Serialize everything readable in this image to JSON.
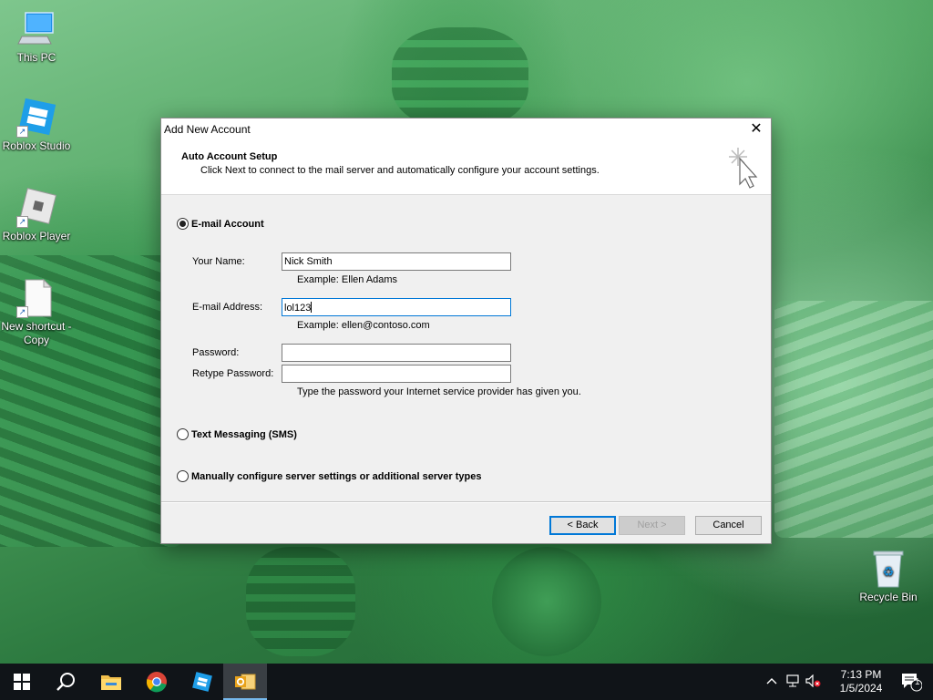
{
  "desktop": {
    "icons": [
      {
        "label": "This PC"
      },
      {
        "label": "Roblox Studio"
      },
      {
        "label": "Roblox Player"
      },
      {
        "label": "New shortcut - Copy"
      },
      {
        "label": "Recycle Bin"
      }
    ]
  },
  "dialog": {
    "title": "Add New Account",
    "close_glyph": "✕",
    "header": {
      "title": "Auto Account Setup",
      "subtitle": "Click Next to connect to the mail server and automatically configure your account settings."
    },
    "options": {
      "email": {
        "label": "E-mail Account",
        "checked": true
      },
      "sms": {
        "label": "Text Messaging (SMS)",
        "checked": false
      },
      "manual": {
        "label": "Manually configure server settings or additional server types",
        "checked": false
      }
    },
    "fields": {
      "name": {
        "label": "Your Name:",
        "value": "Nick Smith",
        "hint": "Example: Ellen Adams"
      },
      "email": {
        "label": "E-mail Address:",
        "value": "lol123",
        "hint": "Example: ellen@contoso.com"
      },
      "password": {
        "label": "Password:",
        "value": ""
      },
      "retype": {
        "label": "Retype Password:",
        "value": ""
      },
      "password_hint": "Type the password your Internet service provider has given you."
    },
    "buttons": {
      "back": "< Back",
      "next": "Next >",
      "cancel": "Cancel"
    }
  },
  "taskbar": {
    "clock": {
      "time": "7:13 PM",
      "date": "1/5/2024"
    },
    "notification_count": "1",
    "icons": [
      "windows-start-icon",
      "search-icon",
      "file-explorer-icon",
      "chrome-icon",
      "roblox-studio-icon",
      "outlook-icon"
    ]
  },
  "colors": {
    "accent": "#0078d7",
    "taskbar": "#101418"
  }
}
